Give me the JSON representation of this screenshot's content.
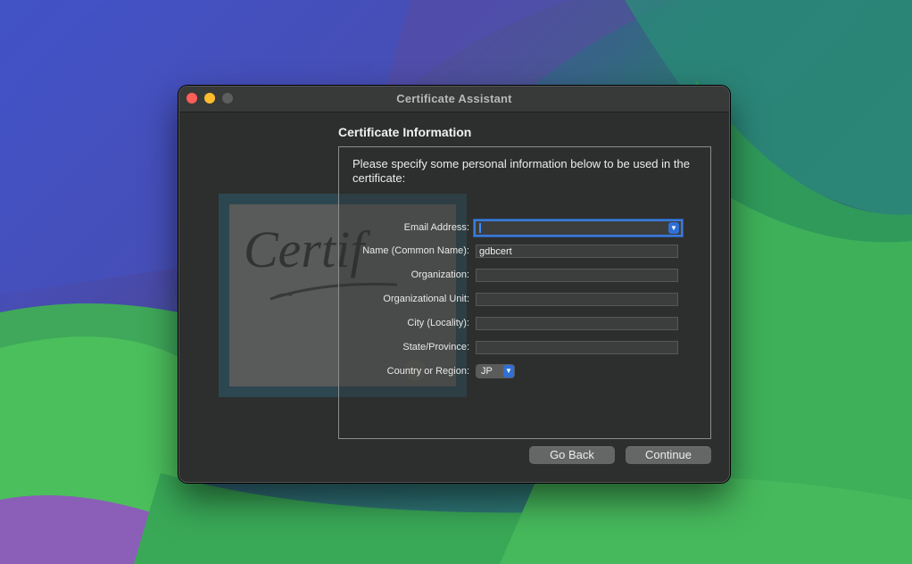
{
  "window": {
    "title": "Certificate Assistant"
  },
  "section": {
    "title": "Certificate Information"
  },
  "panel": {
    "description": "Please specify some personal information below to be used in the certificate:"
  },
  "art": {
    "watermark_text": "Certificate"
  },
  "form": {
    "email": {
      "label": "Email Address:",
      "value": ""
    },
    "name": {
      "label": "Name (Common Name):",
      "value": "gdbcert"
    },
    "organization": {
      "label": "Organization:",
      "value": ""
    },
    "org_unit": {
      "label": "Organizational Unit:",
      "value": ""
    },
    "city": {
      "label": "City (Locality):",
      "value": ""
    },
    "state": {
      "label": "State/Province:",
      "value": ""
    },
    "country": {
      "label": "Country or Region:",
      "value": "JP"
    }
  },
  "buttons": {
    "back": "Go Back",
    "continue": "Continue"
  },
  "icons": {
    "dropdown": "chevron-down-icon"
  },
  "colors": {
    "accent": "#2f6fd6",
    "close": "#ff5f57",
    "minimize": "#febc2e"
  }
}
